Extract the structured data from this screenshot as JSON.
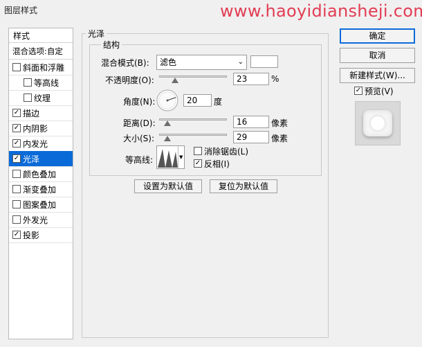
{
  "window": {
    "title": "图层样式"
  },
  "watermark": "www.haoyidiansheji.com",
  "left_panel": {
    "header": "样式",
    "blend_options": "混合选项:自定",
    "items": [
      {
        "label": "斜面和浮雕",
        "checked": false,
        "selected": false,
        "indent": false
      },
      {
        "label": "等高线",
        "checked": false,
        "selected": false,
        "indent": true
      },
      {
        "label": "纹理",
        "checked": false,
        "selected": false,
        "indent": true
      },
      {
        "label": "描边",
        "checked": true,
        "selected": false,
        "indent": false
      },
      {
        "label": "内阴影",
        "checked": true,
        "selected": false,
        "indent": false
      },
      {
        "label": "内发光",
        "checked": true,
        "selected": false,
        "indent": false
      },
      {
        "label": "光泽",
        "checked": true,
        "selected": true,
        "indent": false
      },
      {
        "label": "颜色叠加",
        "checked": false,
        "selected": false,
        "indent": false
      },
      {
        "label": "渐变叠加",
        "checked": false,
        "selected": false,
        "indent": false
      },
      {
        "label": "图案叠加",
        "checked": false,
        "selected": false,
        "indent": false
      },
      {
        "label": "外发光",
        "checked": false,
        "selected": false,
        "indent": false
      },
      {
        "label": "投影",
        "checked": true,
        "selected": false,
        "indent": false
      }
    ]
  },
  "satin": {
    "group_title": "光泽",
    "structure_title": "结构",
    "blend_mode_label": "混合模式(B):",
    "blend_mode_value": "滤色",
    "blend_color": "#ffffff",
    "opacity_label": "不透明度(O):",
    "opacity_value": "23",
    "opacity_unit": "%",
    "angle_label": "角度(N):",
    "angle_value": "20",
    "angle_unit": "度",
    "distance_label": "距离(D):",
    "distance_value": "16",
    "distance_unit": "像素",
    "size_label": "大小(S):",
    "size_value": "29",
    "size_unit": "像素",
    "contour_label": "等高线:",
    "antialias_label": "消除锯齿(L)",
    "antialias_checked": false,
    "invert_label": "反相(I)",
    "invert_checked": true,
    "set_default_label": "设置为默认值",
    "reset_default_label": "复位为默认值",
    "opacity_level": 0.23,
    "distance_level": 0.12,
    "size_level": 0.12
  },
  "right_panel": {
    "ok_label": "确定",
    "cancel_label": "取消",
    "new_style_label": "新建样式(W)...",
    "preview_label": "预览(V)",
    "preview_checked": true
  },
  "colors": {
    "selection": "#0a6ad8",
    "watermark": "#e23c53"
  }
}
